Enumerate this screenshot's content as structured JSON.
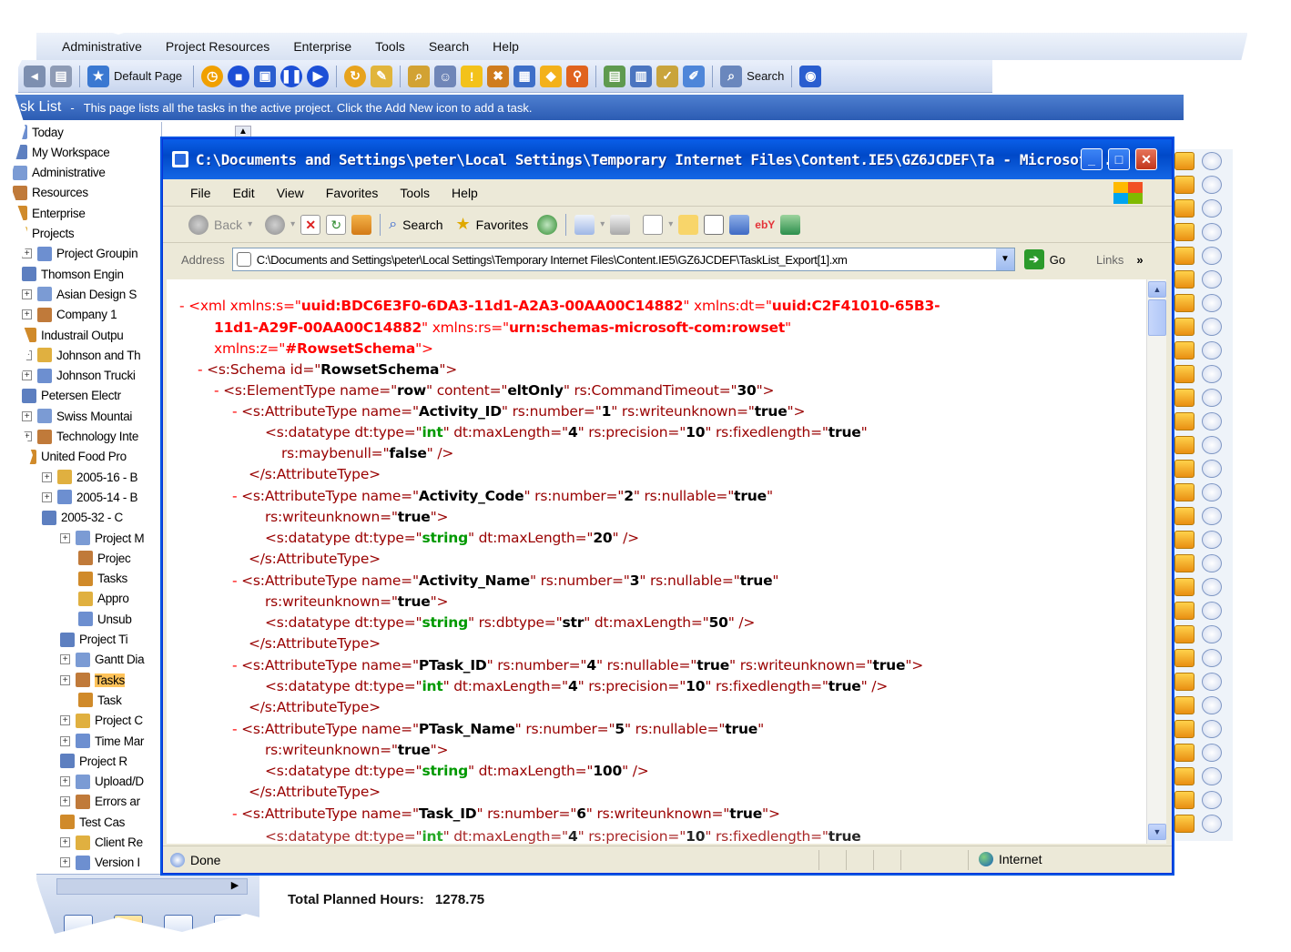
{
  "app": {
    "menu": [
      "Administrative",
      "Project Resources",
      "Enterprise",
      "Tools",
      "Search",
      "Help"
    ],
    "toolbar": {
      "default_page": "Default Page",
      "search": "Search"
    },
    "titlebar": {
      "title": "sk List",
      "sep": "-",
      "description": "This page lists all the tasks in the active project. Click the Add New icon to add a task."
    },
    "tree": [
      {
        "label": "Today",
        "indent": 0
      },
      {
        "label": "My Workspace",
        "indent": 0
      },
      {
        "label": "Administrative",
        "indent": 0
      },
      {
        "label": "Resources",
        "indent": 0
      },
      {
        "label": "Enterprise",
        "indent": 0
      },
      {
        "label": "Projects",
        "indent": 0
      },
      {
        "label": "Project Groupin",
        "indent": 1
      },
      {
        "label": "Thomson Engin",
        "indent": 1
      },
      {
        "label": "Asian Design S",
        "indent": 1
      },
      {
        "label": "Company 1",
        "indent": 1
      },
      {
        "label": "Industrail Outpu",
        "indent": 1
      },
      {
        "label": "Johnson and Th",
        "indent": 1
      },
      {
        "label": "Johnson Trucki",
        "indent": 1
      },
      {
        "label": "Petersen Electr",
        "indent": 1
      },
      {
        "label": "Swiss Mountai",
        "indent": 1
      },
      {
        "label": "Technology Inte",
        "indent": 1
      },
      {
        "label": "United Food Pro",
        "indent": 1
      },
      {
        "label": "2005-16 - B",
        "indent": 2
      },
      {
        "label": "2005-14 - B",
        "indent": 2
      },
      {
        "label": "2005-32 - C",
        "indent": 2
      },
      {
        "label": "Project M",
        "indent": 3
      },
      {
        "label": "Projec",
        "indent": 4
      },
      {
        "label": "Tasks",
        "indent": 4
      },
      {
        "label": "Appro",
        "indent": 4
      },
      {
        "label": "Unsub",
        "indent": 4
      },
      {
        "label": "Project Ti",
        "indent": 3
      },
      {
        "label": "Gantt Dia",
        "indent": 3
      },
      {
        "label": "Tasks",
        "indent": 3,
        "selected": true
      },
      {
        "label": "Task",
        "indent": 4
      },
      {
        "label": "Project C",
        "indent": 3
      },
      {
        "label": "Time Mar",
        "indent": 3
      },
      {
        "label": "Project R",
        "indent": 3
      },
      {
        "label": "Upload/D",
        "indent": 3
      },
      {
        "label": "Errors ar",
        "indent": 3
      },
      {
        "label": "Test Cas",
        "indent": 3
      },
      {
        "label": "Client Re",
        "indent": 3
      },
      {
        "label": "Version I",
        "indent": 3
      }
    ],
    "totals": {
      "label": "Total Planned Hours:",
      "value": "1278.75"
    }
  },
  "ie": {
    "title": "C:\\Documents and Settings\\peter\\Local Settings\\Temporary Internet Files\\Content.IE5\\GZ6JCDEF\\Ta - Microsof...",
    "menu": [
      "File",
      "Edit",
      "View",
      "Favorites",
      "Tools",
      "Help"
    ],
    "toolbar": {
      "back": "Back",
      "search": "Search",
      "favorites": "Favorites"
    },
    "address_label": "Address",
    "address_value": "C:\\Documents and Settings\\peter\\Local Settings\\Temporary Internet Files\\Content.IE5\\GZ6JCDEF\\TaskList_Export[1].xm",
    "go": "Go",
    "links": "Links",
    "status_done": "Done",
    "status_zone": "Internet"
  },
  "xml": {
    "l1a": "- <xml xmlns:s=\"",
    "l1b": "uuid:BDC6E3F0-6DA3-11d1-A2A3-00AA00C14882",
    "l1c": "\" xmlns:dt=\"",
    "l1d": "uuid:C2F41010-65B3-",
    "l2a": "11d1-A29F-00AA00C14882",
    "l2b": "\" xmlns:rs=\"",
    "l2c": "urn:schemas-microsoft-com:rowset",
    "l2d": "\"",
    "l3a": "xmlns:z=\"",
    "l3b": "#RowsetSchema",
    "l3c": "\">",
    "schema": "RowsetSchema",
    "elementtype": {
      "name": "row",
      "content": "eltOnly",
      "timeout": "30"
    },
    "attributes": [
      {
        "name": "Activity_ID",
        "number": "1"
      },
      {
        "name": "Activity_Code",
        "number": "2"
      },
      {
        "name": "Activity_Name",
        "number": "3"
      },
      {
        "name": "PTask_ID",
        "number": "4"
      },
      {
        "name": "PTask_Name",
        "number": "5"
      },
      {
        "name": "Task_ID",
        "number": "6"
      }
    ],
    "true": "true",
    "false": "false",
    "int": "int",
    "string": "string",
    "str": "str",
    "len4": "4",
    "len20": "20",
    "len50": "50",
    "len100": "100",
    "prec10": "10"
  },
  "colors": {
    "accent": "#2c5cb3",
    "xml_markup": "#990000",
    "xml_namespace": "#ff0000",
    "xml_datatype": "#009900"
  }
}
